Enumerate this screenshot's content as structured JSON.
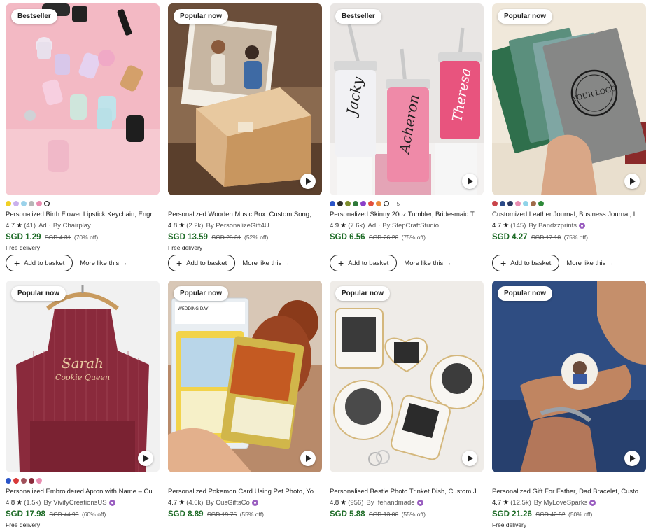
{
  "products": [
    {
      "badge": "Bestseller",
      "has_video": false,
      "swatches": [
        "#f0d024",
        "#c9b0ec",
        "#9bd2ea",
        "#b7b7b7",
        "#e98cb0",
        "#ffffff"
      ],
      "more_swatches": "",
      "title": "Personalized Birth Flower Lipstick Keychain, Engra...",
      "rating": "4.7",
      "reviews": "(41)",
      "ad": "Ad",
      "seller": "By Chairplay",
      "star_seller": false,
      "price": "SGD 1.29",
      "original_price": "SGD 4.31",
      "discount": "(70% off)",
      "free_delivery": "Free delivery",
      "add_to_basket": "Add to basket",
      "more_like_this": "More like this →"
    },
    {
      "badge": "Popular now",
      "has_video": true,
      "swatches": [],
      "more_swatches": "",
      "title": "Personalized Wooden Music Box: Custom Song, Ph...",
      "rating": "4.8",
      "reviews": "(2.2k)",
      "ad": "",
      "seller": "By PersonalizeGift4U",
      "star_seller": false,
      "price": "SGD 13.59",
      "original_price": "SGD 28.31",
      "discount": "(52% off)",
      "free_delivery": "Free delivery",
      "add_to_basket": "Add to basket",
      "more_like_this": "More like this →"
    },
    {
      "badge": "Bestseller",
      "has_video": true,
      "swatches": [
        "#2a54c8",
        "#2c2c2c",
        "#7c8c2c",
        "#2f7a3a",
        "#8a3fc8",
        "#e2503d",
        "#eb8a3a",
        "#ffffff"
      ],
      "more_swatches": "+5",
      "title": "Personalized Skinny 20oz Tumbler, Bridesmaid Tum...",
      "rating": "4.9",
      "reviews": "(7.6k)",
      "ad": "Ad",
      "seller": "By StepCraftStudio",
      "star_seller": false,
      "price": "SGD 6.56",
      "original_price": "SGD 26.26",
      "discount": "(75% off)",
      "free_delivery": "",
      "add_to_basket": "Add to basket",
      "more_like_this": "More like this →"
    },
    {
      "badge": "Popular now",
      "has_video": true,
      "swatches": [
        "#c9444a",
        "#2b4a88",
        "#2a3760",
        "#e98cb0",
        "#8fd3e8",
        "#a06b4a",
        "#2f8a3a"
      ],
      "more_swatches": "",
      "title": "Customized Leather Journal, Business Journal, Log...",
      "rating": "4.7",
      "reviews": "(145)",
      "ad": "",
      "seller": "By Bandzzprints",
      "star_seller": true,
      "price": "SGD 4.27",
      "original_price": "SGD 17.10",
      "discount": "(75% off)",
      "free_delivery": "",
      "add_to_basket": "Add to basket",
      "more_like_this": "More like this →"
    },
    {
      "badge": "Popular now",
      "has_video": true,
      "swatches": [
        "#2a54c8",
        "#d83a3a",
        "#a0505a",
        "#8a2a3a",
        "#e98cb0"
      ],
      "more_swatches": "",
      "title": "Personalized Embroidered Apron with Name – Cust...",
      "rating": "4.8",
      "reviews": "(1.5k)",
      "ad": "",
      "seller": "By VivifyCreationsUS",
      "star_seller": true,
      "price": "SGD 17.98",
      "original_price": "SGD 44.93",
      "discount": "(60% off)",
      "free_delivery": "Free delivery",
      "add_to_basket": "",
      "more_like_this": ""
    },
    {
      "badge": "Popular now",
      "has_video": true,
      "swatches": [],
      "more_swatches": "",
      "title": "Personalized Pokemon Card Using Pet Photo, Your ...",
      "rating": "4.7",
      "reviews": "(4.6k)",
      "ad": "",
      "seller": "By CusGiftsCo",
      "star_seller": true,
      "price": "SGD 8.89",
      "original_price": "SGD 19.75",
      "discount": "(55% off)",
      "free_delivery": "",
      "add_to_basket": "",
      "more_like_this": ""
    },
    {
      "badge": "Popular now",
      "has_video": true,
      "swatches": [],
      "more_swatches": "",
      "title": "Personalised Bestie Photo Trinket Dish, Custom Je...",
      "rating": "4.8",
      "reviews": "(956)",
      "ad": "",
      "seller": "By Ifehandmade",
      "star_seller": true,
      "price": "SGD 5.88",
      "original_price": "SGD 13.06",
      "discount": "(55% off)",
      "free_delivery": "",
      "add_to_basket": "",
      "more_like_this": ""
    },
    {
      "badge": "Popular now",
      "has_video": true,
      "swatches": [],
      "more_swatches": "",
      "title": "Personalized Gift For Father, Dad Bracelet, Custom ...",
      "rating": "4.7",
      "reviews": "(12.5k)",
      "ad": "",
      "seller": "By MyLoveSparks",
      "star_seller": true,
      "price": "SGD 21.26",
      "original_price": "SGD 42.52",
      "discount": "(50% off)",
      "free_delivery": "Free delivery",
      "add_to_basket": "",
      "more_like_this": ""
    }
  ],
  "image_text": {
    "tumbler_names": [
      "Jacky",
      "Acheron",
      "Theresa"
    ],
    "journal_logo": "YOUR LOGO",
    "apron_name": "Sarah",
    "apron_subtitle": "Cookie Queen",
    "card_slab_label": "WEDDING DAY"
  }
}
